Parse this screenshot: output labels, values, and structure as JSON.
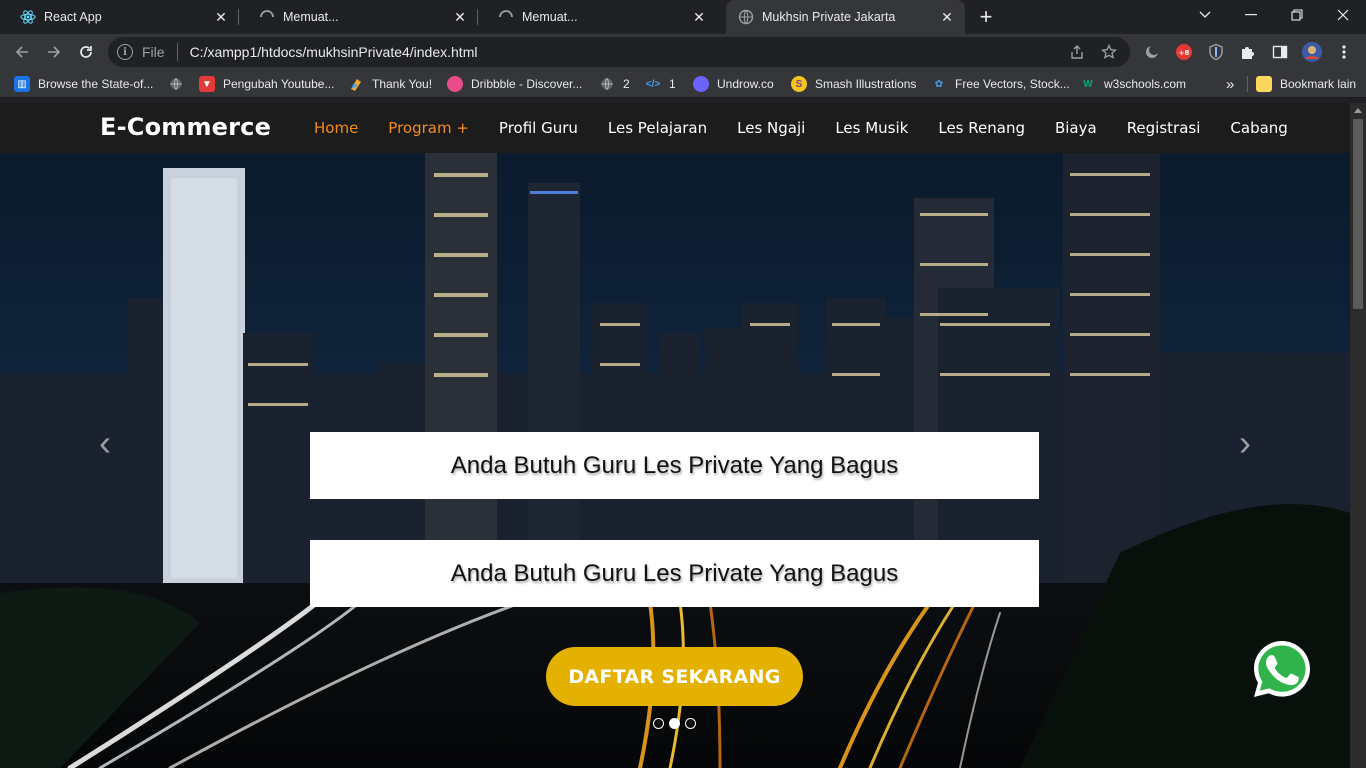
{
  "tabs": [
    {
      "title": "React App",
      "icon": "react-icon",
      "active": false
    },
    {
      "title": "Memuat...",
      "icon": "loading-spinner-icon",
      "active": false
    },
    {
      "title": "Memuat...",
      "icon": "loading-spinner-icon",
      "active": false
    },
    {
      "title": "Mukhsin Private Jakarta",
      "icon": "globe-icon",
      "active": true
    }
  ],
  "address_bar": {
    "scheme_label": "File",
    "url": "C:/xampp1/htdocs/mukhsinPrivate4/index.html"
  },
  "bookmarks": [
    {
      "label": "Browse the State-of...",
      "icon": "papers-icon"
    },
    {
      "label": "",
      "icon": "globe-icon"
    },
    {
      "label": "Pengubah Youtube...",
      "icon": "youtube-icon"
    },
    {
      "label": "Thank You!",
      "icon": "bookmark-icon"
    },
    {
      "label": "Dribbble - Discover...",
      "icon": "dribbble-icon"
    },
    {
      "label": "2",
      "icon": "globe-icon"
    },
    {
      "label": "1",
      "icon": "code-icon"
    },
    {
      "label": "Undrow.co",
      "icon": "undraw-icon"
    },
    {
      "label": "Smash Illustrations",
      "icon": "smash-icon"
    },
    {
      "label": "Free Vectors, Stock...",
      "icon": "freepik-icon"
    },
    {
      "label": "w3schools.com",
      "icon": "w3schools-icon"
    }
  ],
  "bookmarks_overflow": "»",
  "other_bookmarks": "Bookmark lain",
  "site": {
    "brand": "E-Commerce",
    "menu": [
      "Home",
      "Program +",
      "Profil Guru",
      "Les Pelajaran",
      "Les Ngaji",
      "Les Musik",
      "Les Renang",
      "Biaya",
      "Registrasi",
      "Cabang"
    ],
    "accent_color": "#f28c1a",
    "hero": {
      "caption_1": "Anda Butuh Guru Les Private Yang Bagus",
      "caption_2": "Anda Butuh Guru Les Private Yang Bagus",
      "cta": "DAFTAR SEKARANG",
      "cta_color": "#e5b100",
      "prev_arrow": "‹",
      "next_arrow": "›",
      "slide_count": 3,
      "active_slide": 2
    },
    "floating_icon": "whatsapp-icon"
  }
}
